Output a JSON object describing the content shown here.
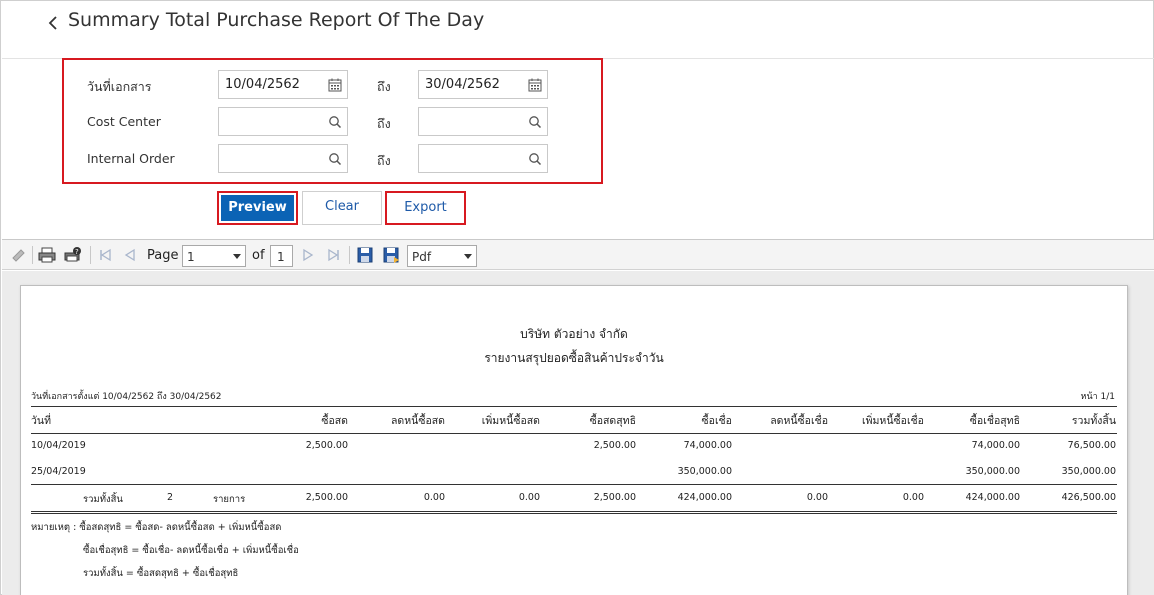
{
  "header": {
    "title": "Summary Total Purchase Report Of The Day"
  },
  "filter": {
    "to_label": "ถึง",
    "doc_date": {
      "label": "วันที่เอกสาร",
      "from": "10/04/2562",
      "to": "30/04/2562"
    },
    "cost_center": {
      "label": "Cost Center",
      "from": "",
      "to": ""
    },
    "internal_order": {
      "label": "Internal Order",
      "from": "",
      "to": ""
    }
  },
  "buttons": {
    "preview": "Preview",
    "clear": "Clear",
    "export": "Export"
  },
  "toolbar": {
    "page_label": "Page",
    "page_value": "1",
    "of_label": "of",
    "total_pages": "1",
    "format": "Pdf"
  },
  "report": {
    "company": "บริษัท ตัวอย่าง จำกัด",
    "title": "รายงานสรุปยอดซื้อสินค้าประจำวัน",
    "date_range": "วันที่เอกสารตั้งแต่ 10/04/2562 ถึง 30/04/2562",
    "page": "หน้า 1/1",
    "columns": [
      "วันที่",
      "ซื้อสด",
      "ลดหนี้ซื้อสด",
      "เพิ่มหนี้ซื้อสด",
      "ซื้อสดสุทธิ",
      "ซื้อเชื่อ",
      "ลดหนี้ซื้อเชื่อ",
      "เพิ่มหนี้ซื้อเชื่อ",
      "ซื้อเชื่อสุทธิ",
      "รวมทั้งสิ้น"
    ],
    "rows": [
      [
        "10/04/2019",
        "2,500.00",
        "",
        "",
        "2,500.00",
        "74,000.00",
        "",
        "",
        "74,000.00",
        "76,500.00"
      ],
      [
        "25/04/2019",
        "",
        "",
        "",
        "",
        "350,000.00",
        "",
        "",
        "350,000.00",
        "350,000.00"
      ]
    ],
    "total": {
      "label": "รวมทั้งสิ้น",
      "count": "2",
      "unit": "รายการ",
      "values": [
        "2,500.00",
        "0.00",
        "0.00",
        "2,500.00",
        "424,000.00",
        "0.00",
        "0.00",
        "424,000.00",
        "426,500.00"
      ]
    },
    "notes": [
      "หมายเหตุ : ซื้อสดสุทธิ = ซื้อสด- ลดหนี้ซื้อสด + เพิ่มหนี้ซื้อสด",
      "ซื้อเชื่อสุทธิ = ซื้อเชื่อ- ลดหนี้ซื้อเชื่อ + เพิ่มหนี้ซื้อเชื่อ",
      "รวมทั้งสิ้น = ซื้อสดสุทธิ + ซื้อเชื่อสุทธิ"
    ]
  },
  "colors": {
    "accent": "#0b63b5",
    "highlight": "#d71920"
  }
}
